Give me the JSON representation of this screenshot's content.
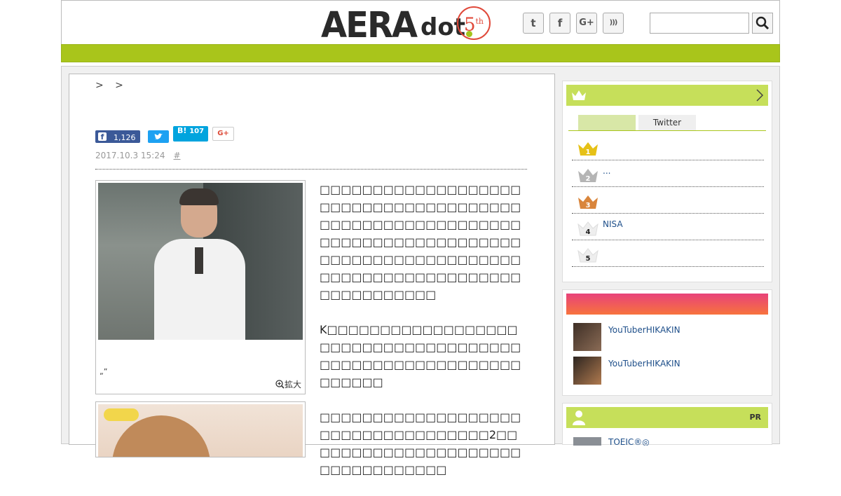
{
  "header": {
    "logo_main": "AERA",
    "logo_sub": "dot",
    "anniversary_number": "5",
    "anniversary_suffix": "th",
    "social_icons": [
      "twitter-icon",
      "facebook-icon",
      "google-plus-icon",
      "rss-icon"
    ],
    "social_glyphs": [
      "t",
      "f",
      "G+",
      ")))"
    ],
    "search": {
      "placeholder": ""
    }
  },
  "article": {
    "breadcrumb_separators": ">  >",
    "share": {
      "facebook_count": "1,126",
      "hatena_label": "B!",
      "hatena_count": "107",
      "google_label": "G+"
    },
    "date": "2017.10.3 15:24",
    "hash": "#",
    "photo_caption": "„”",
    "zoom_label": "拡大",
    "paragraphs": [
      "□□□□□□□□□□□□□□□□□□□□□□□□□□□□□□□□□□□□□□□□□□□□□□□□□□□□□□□□□□□□□□□□□□□□□□□□□□□□□□□□□□□□□□□□□□□□□□□□□□□□□□□□□□□□□□□□□□□□□□□□□□□□□",
      "K□□□□□□□□□□□□□□□□□□□□□□□□□□□□□□□□□□□□□□□□□□□□□□□□□□□□□□□□□□□□□□",
      "□□□□□□□□□□□□□□□□□□□□□□□□□□□□□□□□□□□2□□□□□□□□□□□□□□□□□□□□□□□□□□□□□□□□□"
    ]
  },
  "sidebar": {
    "ranking": {
      "tabs": [
        "",
        "Twitter"
      ],
      "items": [
        {
          "rank": "1",
          "text": "",
          "color": "#e6c117"
        },
        {
          "rank": "2",
          "text": "...",
          "color": "#b5b5b5"
        },
        {
          "rank": "3",
          "text": "",
          "color": "#d9853b"
        },
        {
          "rank": "4",
          "text": "NISA",
          "color": "#eeeeee"
        },
        {
          "rank": "5",
          "text": "",
          "color": "#eeeeee"
        }
      ]
    },
    "videos": [
      {
        "title": "YouTuberHIKAKIN"
      },
      {
        "title": "YouTuberHIKAKIN"
      }
    ],
    "pr": {
      "label": "PR",
      "item_text": "TOEIC®◎"
    }
  },
  "colors": {
    "accent_green": "#a9c51b",
    "sidebar_header_green": "#c6df5a",
    "gradient_start": "#e8427a",
    "gradient_end": "#f7733d",
    "link_blue": "#1e4f8a",
    "facebook": "#3b5998",
    "twitter": "#1da1f2",
    "hatena": "#00a4de"
  }
}
